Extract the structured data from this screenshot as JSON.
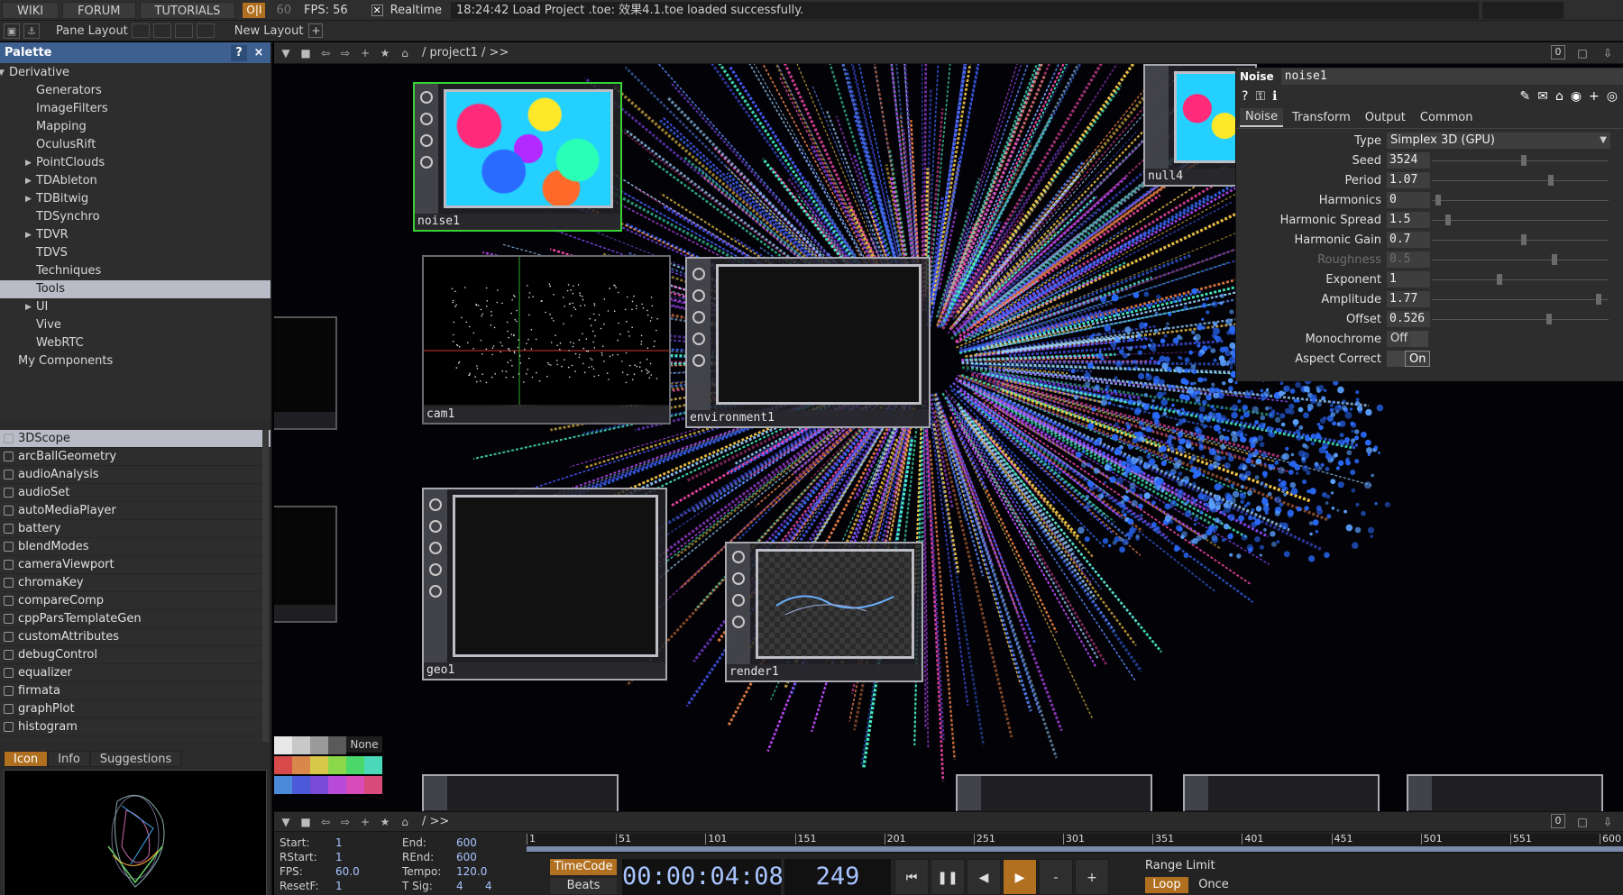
{
  "topbar": {
    "wiki": "WIKI",
    "forum": "FORUM",
    "tutorials": "TUTORIALS",
    "oi": "O|I",
    "sixty": "60",
    "fps": "FPS:  56",
    "check_mark": "✕",
    "realtime": "Realtime",
    "status": "18:24:42 Load Project .toe: 效果4.1.toe loaded successfully."
  },
  "bar2": {
    "pane_layout": "Pane Layout",
    "new_layout": "New Layout",
    "plus": "+"
  },
  "palette": {
    "title": "Palette",
    "help": "?",
    "close": "×",
    "tree": [
      {
        "label": "Derivative",
        "level": 0,
        "arrow": "▼"
      },
      {
        "label": "Generators",
        "level": 2
      },
      {
        "label": "ImageFilters",
        "level": 2
      },
      {
        "label": "Mapping",
        "level": 2
      },
      {
        "label": "OculusRift",
        "level": 2
      },
      {
        "label": "PointClouds",
        "level": 2,
        "arrow": "▶"
      },
      {
        "label": "TDAbleton",
        "level": 2,
        "arrow": "▶"
      },
      {
        "label": "TDBitwig",
        "level": 2,
        "arrow": "▶"
      },
      {
        "label": "TDSynchro",
        "level": 2
      },
      {
        "label": "TDVR",
        "level": 2,
        "arrow": "▶"
      },
      {
        "label": "TDVS",
        "level": 2
      },
      {
        "label": "Techniques",
        "level": 2
      },
      {
        "label": "Tools",
        "level": 2,
        "selected": true
      },
      {
        "label": "UI",
        "level": 2,
        "arrow": "▶"
      },
      {
        "label": "Vive",
        "level": 2
      },
      {
        "label": "WebRTC",
        "level": 2
      },
      {
        "label": "My Components",
        "level": 1
      }
    ],
    "components": [
      "3DScope",
      "arcBallGeometry",
      "audioAnalysis",
      "audioSet",
      "autoMediaPlayer",
      "battery",
      "blendModes",
      "cameraViewport",
      "chromaKey",
      "compareComp",
      "cppParsTemplateGen",
      "customAttributes",
      "debugControl",
      "equalizer",
      "firmata",
      "graphPlot",
      "histogram"
    ],
    "tabs": {
      "icon": "Icon",
      "info": "Info",
      "suggestions": "Suggestions"
    }
  },
  "network": {
    "path": "/ project1 / >>",
    "zero": "0",
    "nodes": [
      {
        "id": "noise1",
        "label": "noise1"
      },
      {
        "id": "null4",
        "label": "null4"
      },
      {
        "id": "cam1",
        "label": "cam1"
      },
      {
        "id": "environment1",
        "label": "environment1"
      },
      {
        "id": "geo1",
        "label": "geo1"
      },
      {
        "id": "render1",
        "label": "render1"
      }
    ]
  },
  "params": {
    "op_type": "Noise",
    "op_name": "noise1",
    "tabs": [
      "Noise",
      "Transform",
      "Output",
      "Common"
    ],
    "type_label": "Type",
    "type_value": "Simplex 3D (GPU)",
    "rows": [
      {
        "label": "Seed",
        "value": "3524",
        "pos": 0.52
      },
      {
        "label": "Period",
        "value": "1.07",
        "pos": 0.68
      },
      {
        "label": "Harmonics",
        "value": "0",
        "pos": 0.02
      },
      {
        "label": "Harmonic Spread",
        "value": "1.5",
        "pos": 0.08
      },
      {
        "label": "Harmonic Gain",
        "value": "0.7",
        "pos": 0.52
      },
      {
        "label": "Roughness",
        "value": "0.5",
        "pos": 0.7,
        "disabled": true
      },
      {
        "label": "Exponent",
        "value": "1",
        "pos": 0.38
      },
      {
        "label": "Amplitude",
        "value": "1.77",
        "pos": 0.96
      },
      {
        "label": "Offset",
        "value": "0.526",
        "pos": 0.67
      }
    ],
    "monochrome_label": "Monochrome",
    "monochrome_value": "Off",
    "aspect_label": "Aspect Correct",
    "aspect_value": "On"
  },
  "swatch_none": "None",
  "timeline": {
    "path": "/ >>",
    "zero": "0",
    "start_k": "Start:",
    "start_v": "1",
    "end_k": "End:",
    "end_v": "600",
    "rstart_k": "RStart:",
    "rstart_v": "1",
    "rend_k": "REnd:",
    "rend_v": "600",
    "fps_k": "FPS:",
    "fps_v": "60.0",
    "tempo_k": "Tempo:",
    "tempo_v": "120.0",
    "resetf_k": "ResetF:",
    "resetf_v": "1",
    "tsig_k": "T Sig:",
    "tsig_v1": "4",
    "tsig_v2": "4",
    "ticks": [
      "1",
      "51",
      "101",
      "151",
      "201",
      "251",
      "301",
      "351",
      "401",
      "451",
      "501",
      "551",
      "600"
    ],
    "timecode_btn": "TimeCode",
    "beats_btn": "Beats",
    "timecode": "00:00:04:08",
    "frame": "249",
    "range_limit": "Range Limit",
    "loop": "Loop",
    "once": "Once"
  }
}
